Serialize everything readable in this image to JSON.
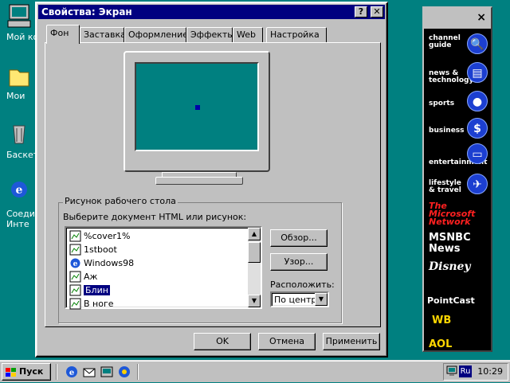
{
  "desktop": {
    "icons": [
      {
        "label": "Мой ко",
        "icon": "my-computer-icon"
      },
      {
        "label": "Мои",
        "icon": "my-documents-icon"
      },
      {
        "label": "Баскет",
        "icon": "recycle-bin-icon"
      },
      {
        "label": "Соеди Инте",
        "icon": "internet-connection-icon"
      }
    ],
    "background_color": "#008080"
  },
  "dialog": {
    "title": "Свойства: Экран",
    "help_button": "?",
    "close_button": "✕",
    "tabs": [
      "Фон",
      "Заставка",
      "Оформление",
      "Эффекты",
      "Web",
      "Настройка"
    ],
    "active_tab": "Фон",
    "group_label": "Рисунок рабочего стола",
    "list_caption": "Выберите документ HTML или рисунок:",
    "list_items": [
      "%cover1%",
      "1stboot",
      "Windows98",
      "Аж",
      "Блин",
      "В ноге"
    ],
    "selected_item": "Блин",
    "browse_button": "Обзор...",
    "pattern_button": "Узор...",
    "position_label": "Расположить:",
    "position_value": "По центру",
    "ok_button": "OK",
    "cancel_button": "Отмена",
    "apply_button": "Применить"
  },
  "channel_bar": {
    "close": "×",
    "channels": [
      {
        "label": "channel guide",
        "icon": "magnifier-icon"
      },
      {
        "label": "news & technology",
        "icon": "news-icon"
      },
      {
        "label": "sports",
        "icon": "sports-icon"
      },
      {
        "label": "business",
        "icon": "dollar-icon"
      },
      {
        "label": "entertainment",
        "icon": "tv-icon"
      },
      {
        "label": "lifestyle & travel",
        "icon": "airplane-icon"
      },
      {
        "label": "The Microsoft Network",
        "icon": "msn-logo"
      },
      {
        "label": "MSNBC News",
        "icon": "msnbc-logo"
      },
      {
        "label": "Disney",
        "icon": "disney-logo"
      },
      {
        "label": "PointCast",
        "icon": "pointcast-logo"
      },
      {
        "label": "WB",
        "icon": "warner-bros-logo"
      },
      {
        "label": "AOL",
        "icon": "aol-logo"
      }
    ]
  },
  "taskbar": {
    "start_label": "Пуск",
    "language": "Ru",
    "clock": "10:29"
  }
}
